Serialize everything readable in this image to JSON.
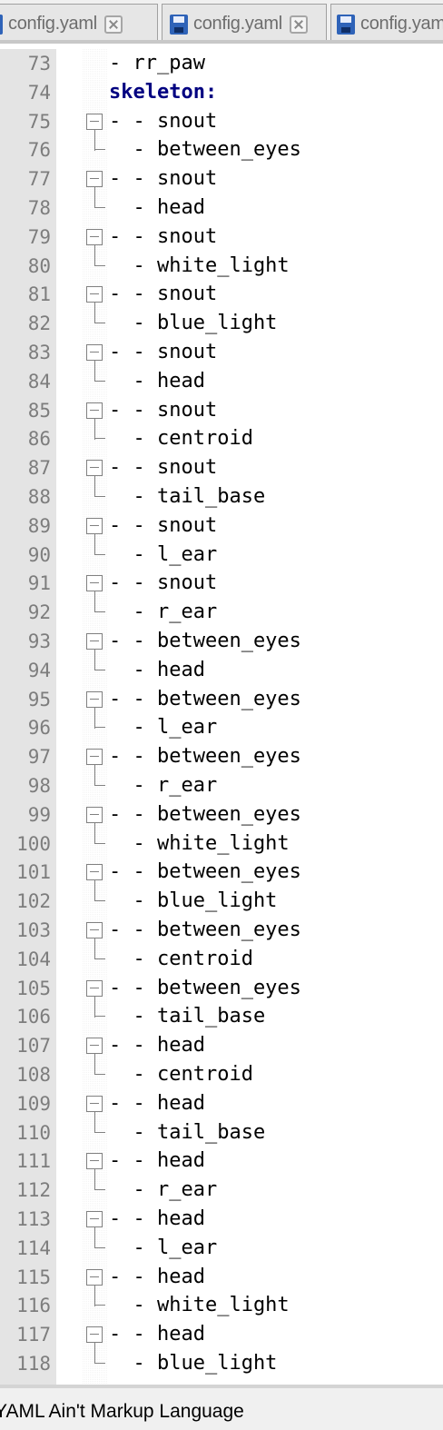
{
  "tabs": [
    {
      "label": "config.yaml"
    },
    {
      "label": "config.yaml"
    },
    {
      "label": "config.yaml"
    }
  ],
  "editor": {
    "lines": [
      {
        "n": "73",
        "text": "- rr_paw"
      },
      {
        "n": "74",
        "key": "skeleton:"
      },
      {
        "n": "75",
        "text": "- - snout",
        "fold": "start"
      },
      {
        "n": "76",
        "text": "  - between_eyes",
        "fold": "end"
      },
      {
        "n": "77",
        "text": "- - snout",
        "fold": "start"
      },
      {
        "n": "78",
        "text": "  - head",
        "fold": "end"
      },
      {
        "n": "79",
        "text": "- - snout",
        "fold": "start"
      },
      {
        "n": "80",
        "text": "  - white_light",
        "fold": "end"
      },
      {
        "n": "81",
        "text": "- - snout",
        "fold": "start"
      },
      {
        "n": "82",
        "text": "  - blue_light",
        "fold": "end"
      },
      {
        "n": "83",
        "text": "- - snout",
        "fold": "start"
      },
      {
        "n": "84",
        "text": "  - head",
        "fold": "end"
      },
      {
        "n": "85",
        "text": "- - snout",
        "fold": "start"
      },
      {
        "n": "86",
        "text": "  - centroid",
        "fold": "end"
      },
      {
        "n": "87",
        "text": "- - snout",
        "fold": "start"
      },
      {
        "n": "88",
        "text": "  - tail_base",
        "fold": "end"
      },
      {
        "n": "89",
        "text": "- - snout",
        "fold": "start"
      },
      {
        "n": "90",
        "text": "  - l_ear",
        "fold": "end"
      },
      {
        "n": "91",
        "text": "- - snout",
        "fold": "start"
      },
      {
        "n": "92",
        "text": "  - r_ear",
        "fold": "end"
      },
      {
        "n": "93",
        "text": "- - between_eyes",
        "fold": "start"
      },
      {
        "n": "94",
        "text": "  - head",
        "fold": "end"
      },
      {
        "n": "95",
        "text": "- - between_eyes",
        "fold": "start"
      },
      {
        "n": "96",
        "text": "  - l_ear",
        "fold": "end"
      },
      {
        "n": "97",
        "text": "- - between_eyes",
        "fold": "start"
      },
      {
        "n": "98",
        "text": "  - r_ear",
        "fold": "end"
      },
      {
        "n": "99",
        "text": "- - between_eyes",
        "fold": "start"
      },
      {
        "n": "100",
        "text": "  - white_light",
        "fold": "end"
      },
      {
        "n": "101",
        "text": "- - between_eyes",
        "fold": "start"
      },
      {
        "n": "102",
        "text": "  - blue_light",
        "fold": "end"
      },
      {
        "n": "103",
        "text": "- - between_eyes",
        "fold": "start"
      },
      {
        "n": "104",
        "text": "  - centroid",
        "fold": "end"
      },
      {
        "n": "105",
        "text": "- - between_eyes",
        "fold": "start"
      },
      {
        "n": "106",
        "text": "  - tail_base",
        "fold": "end"
      },
      {
        "n": "107",
        "text": "- - head",
        "fold": "start"
      },
      {
        "n": "108",
        "text": "  - centroid",
        "fold": "end"
      },
      {
        "n": "109",
        "text": "- - head",
        "fold": "start"
      },
      {
        "n": "110",
        "text": "  - tail_base",
        "fold": "end"
      },
      {
        "n": "111",
        "text": "- - head",
        "fold": "start"
      },
      {
        "n": "112",
        "text": "  - r_ear",
        "fold": "end"
      },
      {
        "n": "113",
        "text": "- - head",
        "fold": "start"
      },
      {
        "n": "114",
        "text": "  - l_ear",
        "fold": "end"
      },
      {
        "n": "115",
        "text": "- - head",
        "fold": "start"
      },
      {
        "n": "116",
        "text": "  - white_light",
        "fold": "end"
      },
      {
        "n": "117",
        "text": "- - head",
        "fold": "start"
      },
      {
        "n": "118",
        "text": "  - blue_light",
        "fold": "end"
      }
    ]
  },
  "statusbar": {
    "language": "YAML Ain't Markup Language"
  },
  "colors": {
    "key": "#000080",
    "gutter": "#e4e4e4",
    "line_number": "#7d7d7d"
  }
}
